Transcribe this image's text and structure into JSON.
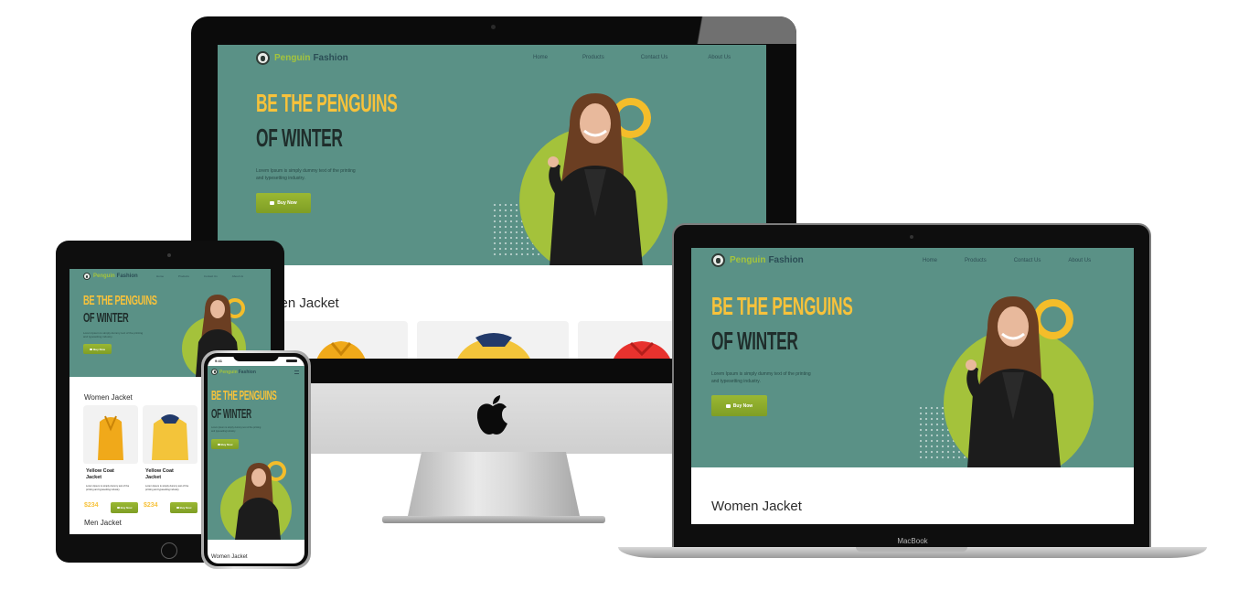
{
  "site": {
    "brand_first": "Penguin",
    "brand_second": "Fashion",
    "nav": [
      "Home",
      "Products",
      "Contact Us",
      "About Us"
    ],
    "hero_line1": "BE THE PENGUINS",
    "hero_line2": "OF WINTER",
    "hero_desc_line1": "Lorem Ipsum is simply dummy text of the printing",
    "hero_desc_line2": "and typesetting industry.",
    "buy_label": "Buy Now",
    "section_women": "Women Jacket",
    "section_women_cropped": "men Jacket",
    "section_men": "Men Jacket"
  },
  "products": [
    {
      "name": "Yellow Coat Jacket",
      "desc": "Lorem Ipsum is simply dummy text of the printing and typesetting industry.",
      "price": "$234",
      "buy": "Buy Now"
    },
    {
      "name": "Yellow Coat Jacket",
      "desc": "Lorem Ipsum is simply dummy text of the printing and typesetting industry.",
      "price": "$234",
      "buy": "Buy Now"
    }
  ],
  "phone_status": {
    "time": "9:41"
  },
  "devices": {
    "macbook_label": "MacBook"
  },
  "colors": {
    "hero_bg": "#5a9186",
    "accent_yellow": "#f7c23b",
    "accent_green": "#a4c23b",
    "heading_dark": "#1f2d2b",
    "button_green": "#8fae2c"
  },
  "icons": [
    "apple-logo-icon",
    "cart-icon",
    "menu-icon",
    "brand-logo-icon",
    "camera-icon",
    "home-button-icon"
  ]
}
